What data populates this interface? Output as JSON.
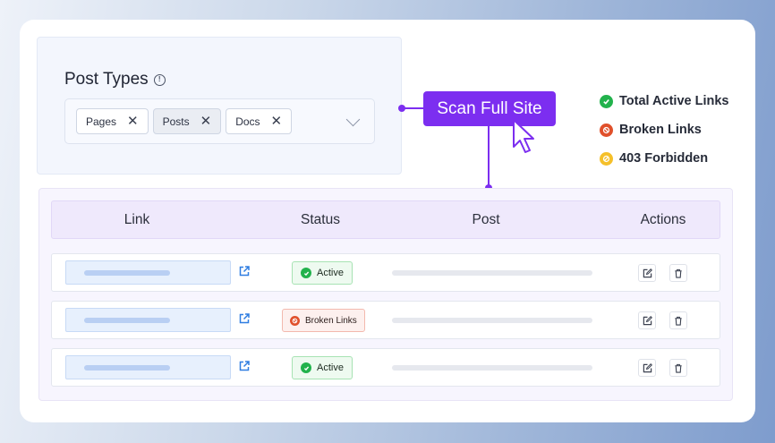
{
  "post_types": {
    "title": "Post Types",
    "chips": [
      {
        "label": "Pages",
        "remove": "✕"
      },
      {
        "label": "Posts",
        "remove": "✕"
      },
      {
        "label": "Docs",
        "remove": "✕"
      }
    ]
  },
  "scan_button": {
    "label": "Scan Full Site"
  },
  "legend": [
    {
      "label": "Total Active Links",
      "color": "#22b24c",
      "icon": "check-circle-icon"
    },
    {
      "label": "Broken Links",
      "color": "#e0502b",
      "icon": "broken-link-icon"
    },
    {
      "label": "403 Forbidden",
      "color": "#f5c02a",
      "icon": "forbidden-icon"
    }
  ],
  "table": {
    "headers": {
      "link": "Link",
      "status": "Status",
      "post": "Post",
      "actions": "Actions"
    },
    "rows": [
      {
        "status": "Active",
        "status_type": "ok"
      },
      {
        "status": "Broken Links",
        "status_type": "bad"
      },
      {
        "status": "Active",
        "status_type": "ok"
      }
    ]
  },
  "colors": {
    "accent": "#7c2ef0",
    "active": "#22b24c",
    "broken": "#e0502b",
    "forbidden": "#f5c02a"
  }
}
